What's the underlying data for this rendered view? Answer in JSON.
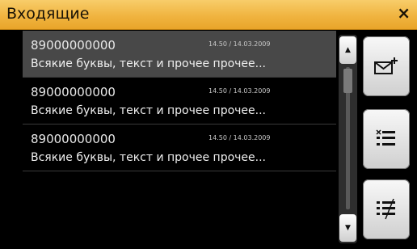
{
  "window": {
    "title": "Входящие",
    "close_label": "×"
  },
  "messages": [
    {
      "phone": "89000000000",
      "datetime": "14.50 / 14.03.2009",
      "preview": "Всякие буквы, текст и прочее прочее...",
      "selected": true
    },
    {
      "phone": "89000000000",
      "datetime": "14.50 / 14.03.2009",
      "preview": "Всякие буквы, текст и прочее прочее...",
      "selected": false
    },
    {
      "phone": "89000000000",
      "datetime": "14.50 / 14.03.2009",
      "preview": "Всякие буквы, текст и прочее прочее...",
      "selected": false
    }
  ],
  "scrollbar": {
    "up_icon": "▲",
    "down_icon": "▼"
  },
  "side_buttons": [
    {
      "icon": "new-message-icon"
    },
    {
      "icon": "list-delete-icon"
    },
    {
      "icon": "list-mark-icon"
    }
  ]
}
